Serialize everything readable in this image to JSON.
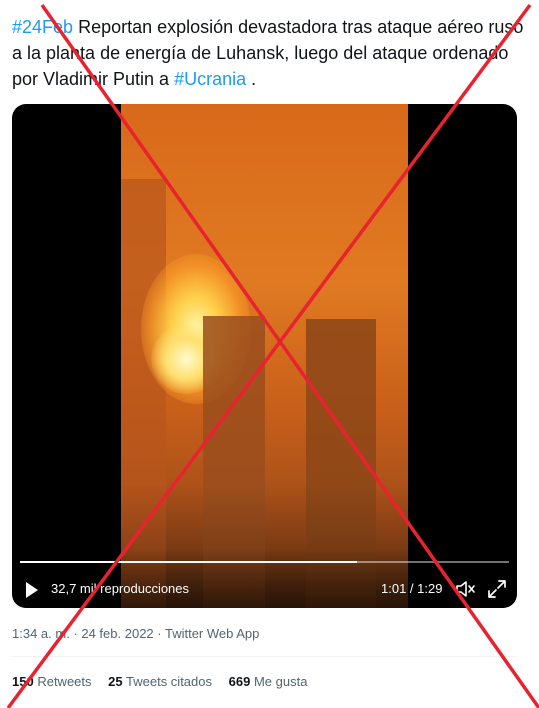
{
  "tweet": {
    "hashtag1": "#24Feb",
    "text_part1": " Reportan explosión devastadora tras ataque aéreo ruso a la planta de energía de Luhansk, luego del ataque ordenado por Vladimir Putin a ",
    "hashtag2": "#Ucrania",
    "text_part2": " ."
  },
  "video": {
    "views": "32,7 mil reproducciones",
    "time": "1:01 / 1:29",
    "progress_fraction": 0.69
  },
  "meta": {
    "timestamp": "1:34 a. m. · 24 feb. 2022 · Twitter Web App"
  },
  "stats": {
    "retweets_count": "150",
    "retweets_label": "Retweets",
    "quotes_count": "25",
    "quotes_label": "Tweets citados",
    "likes_count": "669",
    "likes_label": "Me gusta"
  },
  "colors": {
    "link": "#1d9bf0",
    "overlay_cross": "#e8232f"
  },
  "icons": {
    "play": "play-icon",
    "volume": "volume-muted-icon",
    "fullscreen": "fullscreen-icon"
  }
}
